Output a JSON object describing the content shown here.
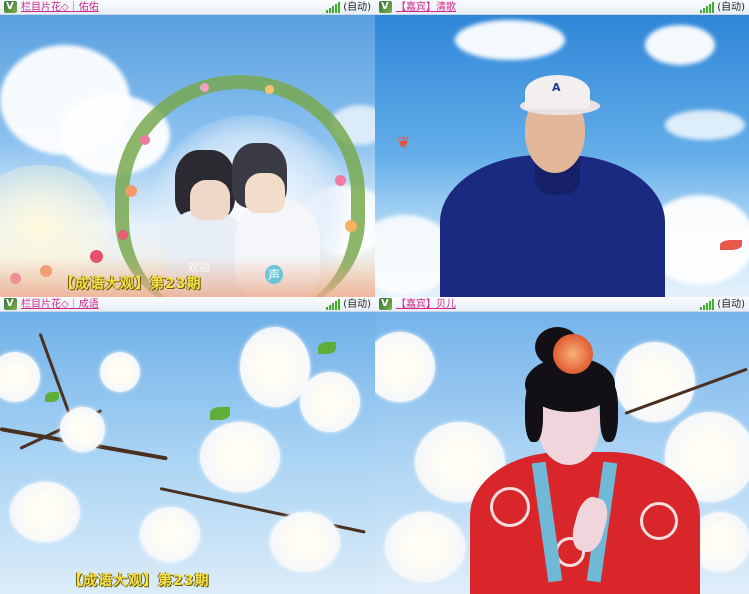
{
  "tiles": [
    {
      "title": "栏目片花◇｜佑佑",
      "mode": "(自动)",
      "caption": "【成语大观】第23期",
      "overlay_marks": [
        "欢迎",
        "声"
      ],
      "icons": {
        "app": "video-app-icon",
        "status": "signal-strength-icon"
      }
    },
    {
      "title": "【嘉宾】清歌",
      "mode": "(自动)",
      "icons": {
        "app": "video-app-icon",
        "status": "signal-strength-icon"
      }
    },
    {
      "title": "栏目片花◇｜成语",
      "mode": "(自动)",
      "caption": "【成语大观】第23期",
      "icons": {
        "app": "video-app-icon",
        "status": "signal-strength-icon"
      }
    },
    {
      "title": "【嘉宾】贝儿",
      "mode": "(自动)",
      "icons": {
        "app": "video-app-icon",
        "status": "signal-strength-icon"
      }
    }
  ],
  "colors": {
    "title_text": "#d0288a",
    "caption_text": "#f5e24a",
    "signal": "#3fae2a"
  }
}
